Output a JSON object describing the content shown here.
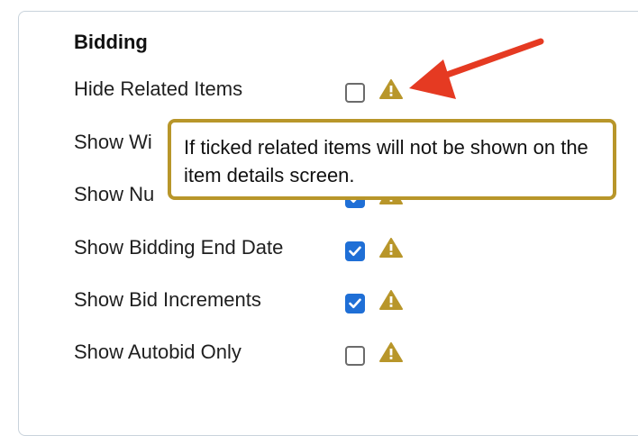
{
  "section": {
    "title": "Bidding"
  },
  "rows": [
    {
      "label": "Hide Related Items",
      "checked": false
    },
    {
      "label": "Show Wi",
      "checked": true
    },
    {
      "label": "Show Nu",
      "checked": true
    },
    {
      "label": "Show Bidding End Date",
      "checked": true
    },
    {
      "label": "Show Bid Increments",
      "checked": true
    },
    {
      "label": "Show Autobid Only",
      "checked": false
    }
  ],
  "tooltip": {
    "text": "If ticked related items will not be shown on the item details screen."
  },
  "icons": {
    "warning": "warning-triangle-icon",
    "annotation": "red-arrow-icon"
  },
  "colors": {
    "checkbox_checked": "#1f6fd6",
    "warning": "#b8962a",
    "tooltip_border": "#b8962a",
    "arrow": "#e53a22"
  }
}
